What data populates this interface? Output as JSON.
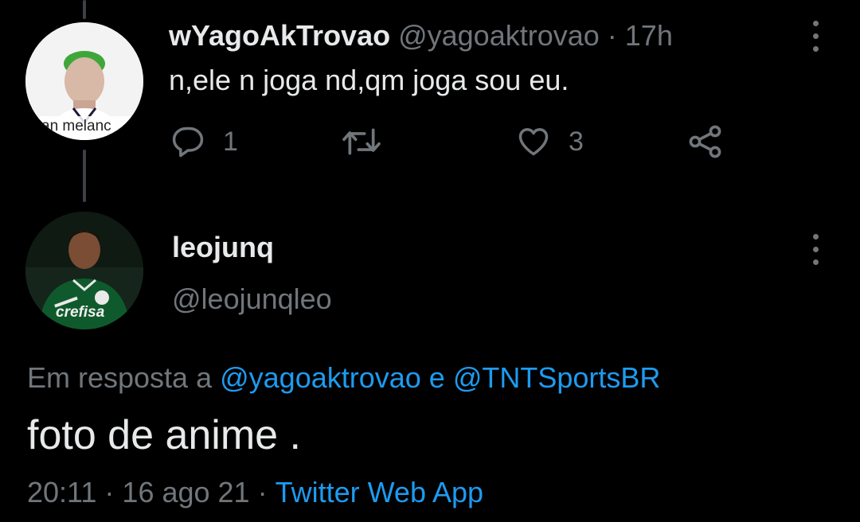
{
  "parent_tweet": {
    "display_name": "wYagoAkTrovao",
    "handle": "@yagoaktrovao",
    "separator": "·",
    "time": "17h",
    "text": "n,ele n joga nd,qm joga sou eu.",
    "avatar_caption": "an melanc",
    "reply_count": "1",
    "retweet_count": "",
    "like_count": "3"
  },
  "main_tweet": {
    "display_name": "leojunq",
    "handle": "@leojunqleo",
    "avatar_caption": "crefisa",
    "reply_prefix": "Em resposta a",
    "reply_to_1": "@yagoaktrovao",
    "reply_conj": "e",
    "reply_to_2": "@TNTSportsBR",
    "text": "foto de anime .",
    "time": "20:11",
    "separator": "·",
    "date": "16 ago 21",
    "separator2": "·",
    "source": "Twitter Web App"
  },
  "colors": {
    "background": "#000000",
    "text": "#e7e9ea",
    "muted": "#71767b",
    "link": "#1d9bf0"
  },
  "icons": [
    "reply-icon",
    "retweet-icon",
    "like-icon",
    "share-icon",
    "more-icon"
  ]
}
